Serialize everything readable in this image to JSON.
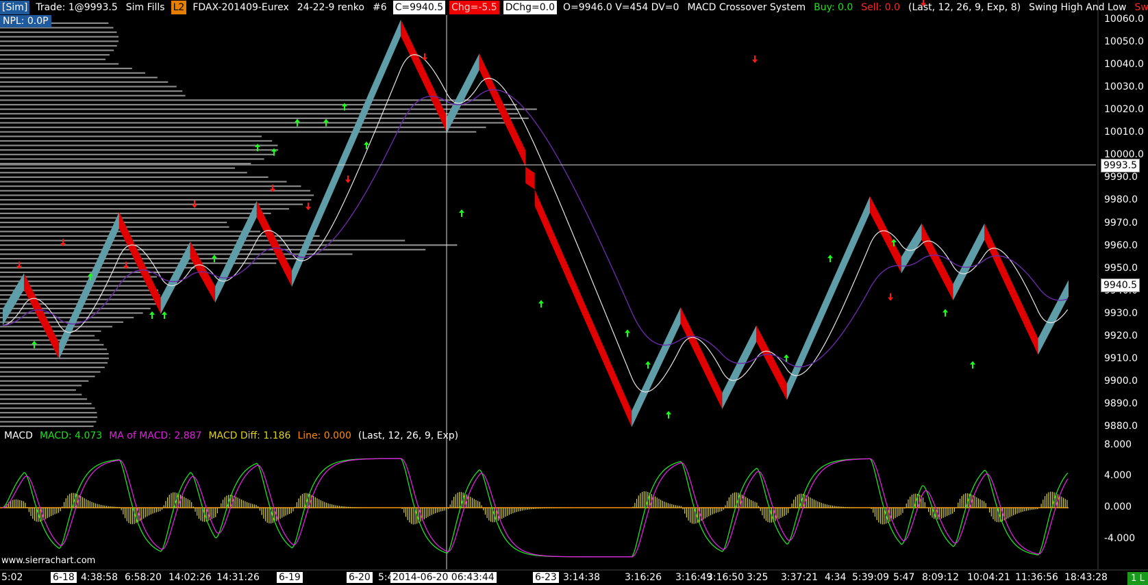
{
  "header": {
    "sim_tag": "[Sim]",
    "trade": "Trade: 1@9993.5",
    "sim_fills": "Sim Fills",
    "l2": "L2",
    "symbol": "FDAX-201409-Eurex",
    "chart_type": "24-22-9 renko",
    "chart_num": "#6",
    "close": "C=9940.5",
    "chg": "Chg=-5.5",
    "dchg": "DChg=0.0",
    "ov": "O=9946.0 V=454 DV=0",
    "study": "MACD Crossover System",
    "buy": "Buy: 0.0",
    "sell": "Sell: 0.0",
    "study_params": "(Last, 12, 26, 9, Exp, 8)",
    "swing_study": "Swing High And Low",
    "swing": "Swing"
  },
  "npl": "NPL: 0.0P",
  "macd_header": {
    "name": "MACD",
    "macd": "MACD: 4.073",
    "ma": "MA of MACD: 2.887",
    "diff": "MACD Diff: 1.186",
    "line": "Line: 0.000",
    "params": "(Last, 12, 26, 9, Exp)"
  },
  "price_axis": [
    "10060.0",
    "10050.0",
    "10040.0",
    "10030.0",
    "10020.0",
    "10010.0",
    "10000.0",
    "9990.0",
    "9980.0",
    "9970.0",
    "9960.0",
    "9950.0",
    "9940.0",
    "9930.0",
    "9920.0",
    "9910.0",
    "9900.0",
    "9890.0",
    "9880.0"
  ],
  "price_cursor": "9993.5",
  "price_last": "9940.5",
  "macd_axis": [
    "8.000",
    "4.000",
    "0.000",
    "-4.000"
  ],
  "time_axis": {
    "plain": [
      "5:02",
      "4:38:58",
      "6:58:20",
      "14:02:26",
      "14:31:26",
      "5:4",
      "3:14:38",
      "3:16:26",
      "3:16:49",
      "3:16:50",
      "3:25",
      "3:37:21",
      "4:34",
      "5:39:09",
      "5:47",
      "8:09:12",
      "10:04:21",
      "11:36:56",
      "18:43:28"
    ],
    "boxed": [
      "6-18",
      "6-19",
      "6-20",
      "6-23"
    ],
    "cursor": "2014-06-20  06:43:44"
  },
  "footer": "www.sierrachart.com",
  "corner": "1 L",
  "colors": {
    "up": "#5f9ea8",
    "down": "#e00000",
    "ma_white": "#e8e8e8",
    "ma_purple": "#6a2aa8",
    "profile": "#8a8a8a",
    "macd": "#1ee11e",
    "signal": "#e020e0",
    "hist": "#d8d040",
    "zero": "#ff8c00"
  },
  "chart_data": {
    "type": "line",
    "price_ylim": [
      9876,
      10066
    ],
    "macd_ylim": [
      -8,
      9
    ],
    "renko_swings": [
      9925,
      9948,
      9910,
      9975,
      9930,
      9962,
      9935,
      9980,
      9942,
      10060,
      10010,
      10045,
      9995,
      9985,
      9880,
      9933,
      9888,
      9925,
      9892,
      9982,
      9948,
      9970,
      9936,
      9970,
      9912,
      9945
    ],
    "up_arrows_price": [
      9920,
      9950,
      9933,
      9933,
      9958,
      10018,
      10018,
      10025,
      10008,
      10005,
      10007,
      9978,
      9938,
      9925,
      9911,
      9889,
      9914,
      9958,
      9965,
      9934,
      9911
    ],
    "down_arrows_price": [
      9948,
      9948,
      9975,
      9974,
      9986,
      10040,
      10039,
      10064,
      9934,
      9982,
      9958
    ]
  }
}
